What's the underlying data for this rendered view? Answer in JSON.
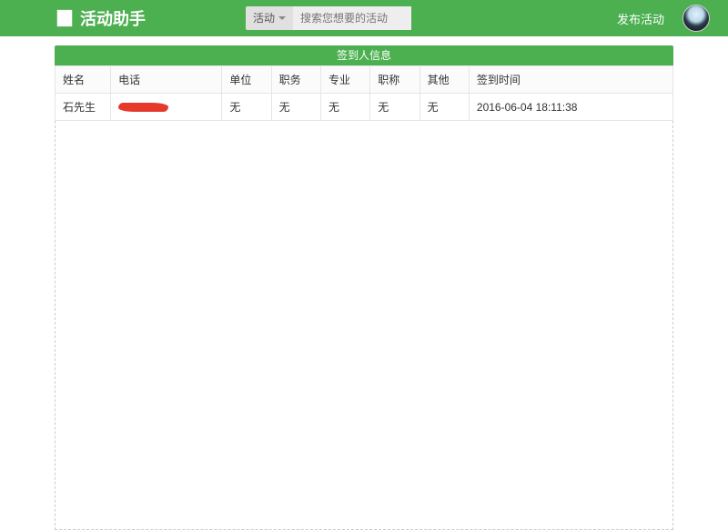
{
  "header": {
    "app_name": "活动助手",
    "category_label": "活动",
    "search_placeholder": "搜索您想要的活动",
    "publish_label": "发布活动"
  },
  "panel": {
    "title": "签到人信息"
  },
  "table": {
    "headers": {
      "name": "姓名",
      "phone": "电话",
      "unit": "单位",
      "job": "职务",
      "major": "专业",
      "title": "职称",
      "other": "其他",
      "time": "签到时间"
    },
    "rows": [
      {
        "name": "石先生",
        "phone": "",
        "unit": "无",
        "job": "无",
        "major": "无",
        "title": "无",
        "other": "无",
        "time": "2016-06-04 18:11:38"
      }
    ]
  }
}
